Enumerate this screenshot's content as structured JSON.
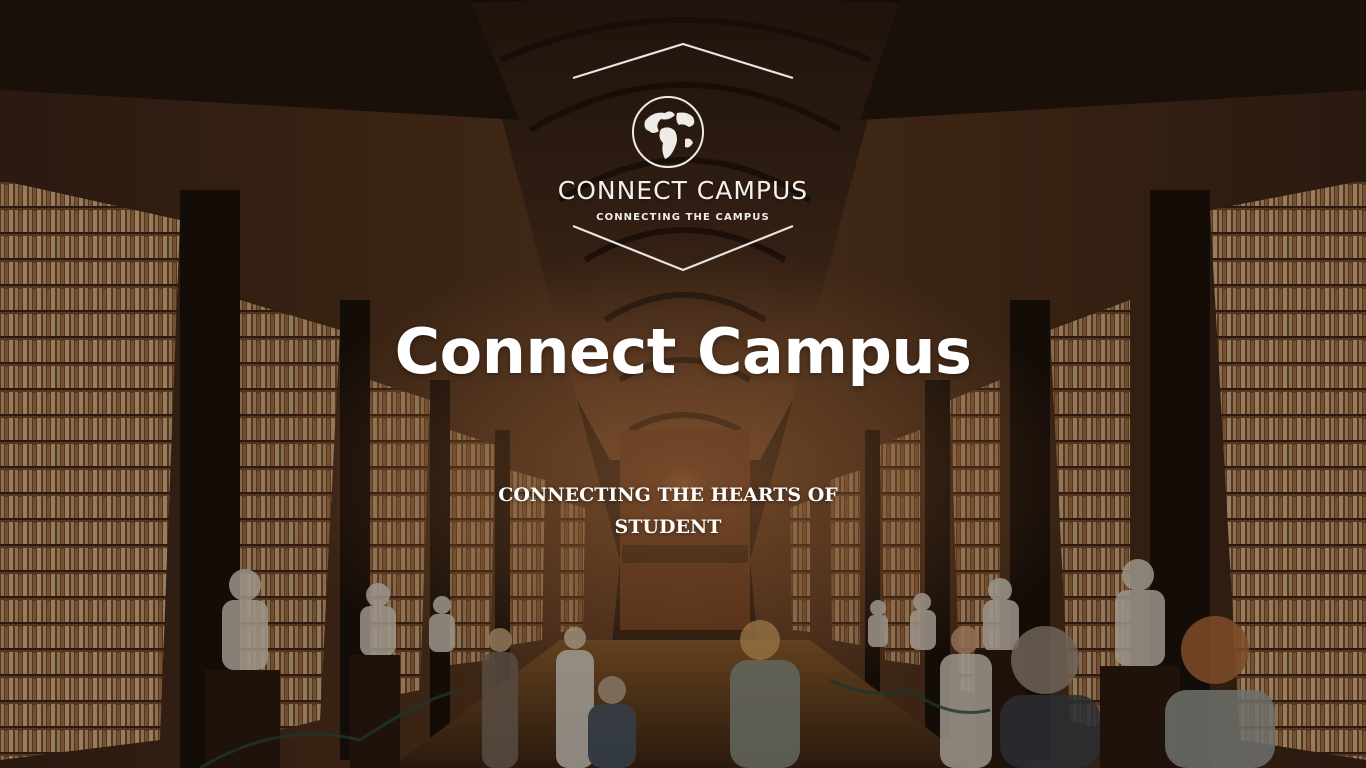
{
  "brand": {
    "logo_title": "CONNECT CAMPUS",
    "logo_subtitle": "CONNECTING THE CAMPUS",
    "logo_icon": "globe-icon"
  },
  "hero": {
    "title": "Connect Campus",
    "tagline": "CONNECTING THE HEARTS OF STUDENT",
    "background": "library-hall-photo"
  },
  "colors": {
    "text": "#ffffff",
    "wood_dark": "#2a1a10",
    "wood_mid": "#6b4226",
    "book_light": "#c89a6a"
  }
}
